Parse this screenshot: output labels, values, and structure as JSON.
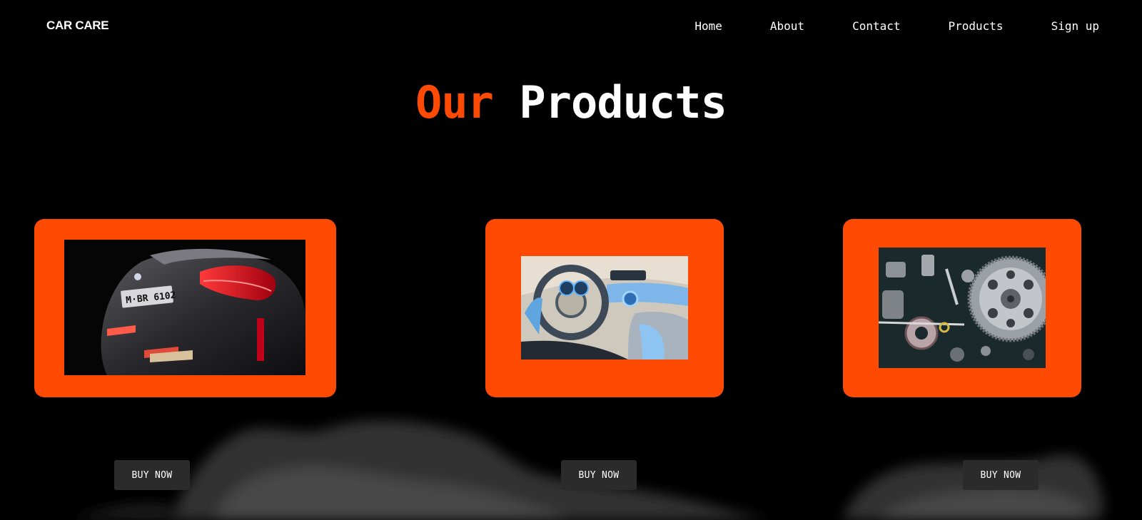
{
  "header": {
    "logo": "CAR CARE",
    "nav": [
      {
        "label": "Home"
      },
      {
        "label": "About"
      },
      {
        "label": "Contact"
      },
      {
        "label": "Products"
      },
      {
        "label": "Sign up"
      }
    ]
  },
  "main": {
    "title_accent": "Our",
    "title_rest": "Products",
    "products": [
      {
        "image": "car-rear-photo",
        "button_label": "BUY NOW"
      },
      {
        "image": "car-interior-photo",
        "button_label": "BUY NOW"
      },
      {
        "image": "car-parts-photo",
        "button_label": "BUY NOW"
      }
    ]
  },
  "colors": {
    "accent": "#ff4a03",
    "background": "#000000",
    "button_bg": "#2b2b2b",
    "text": "#ffffff"
  }
}
